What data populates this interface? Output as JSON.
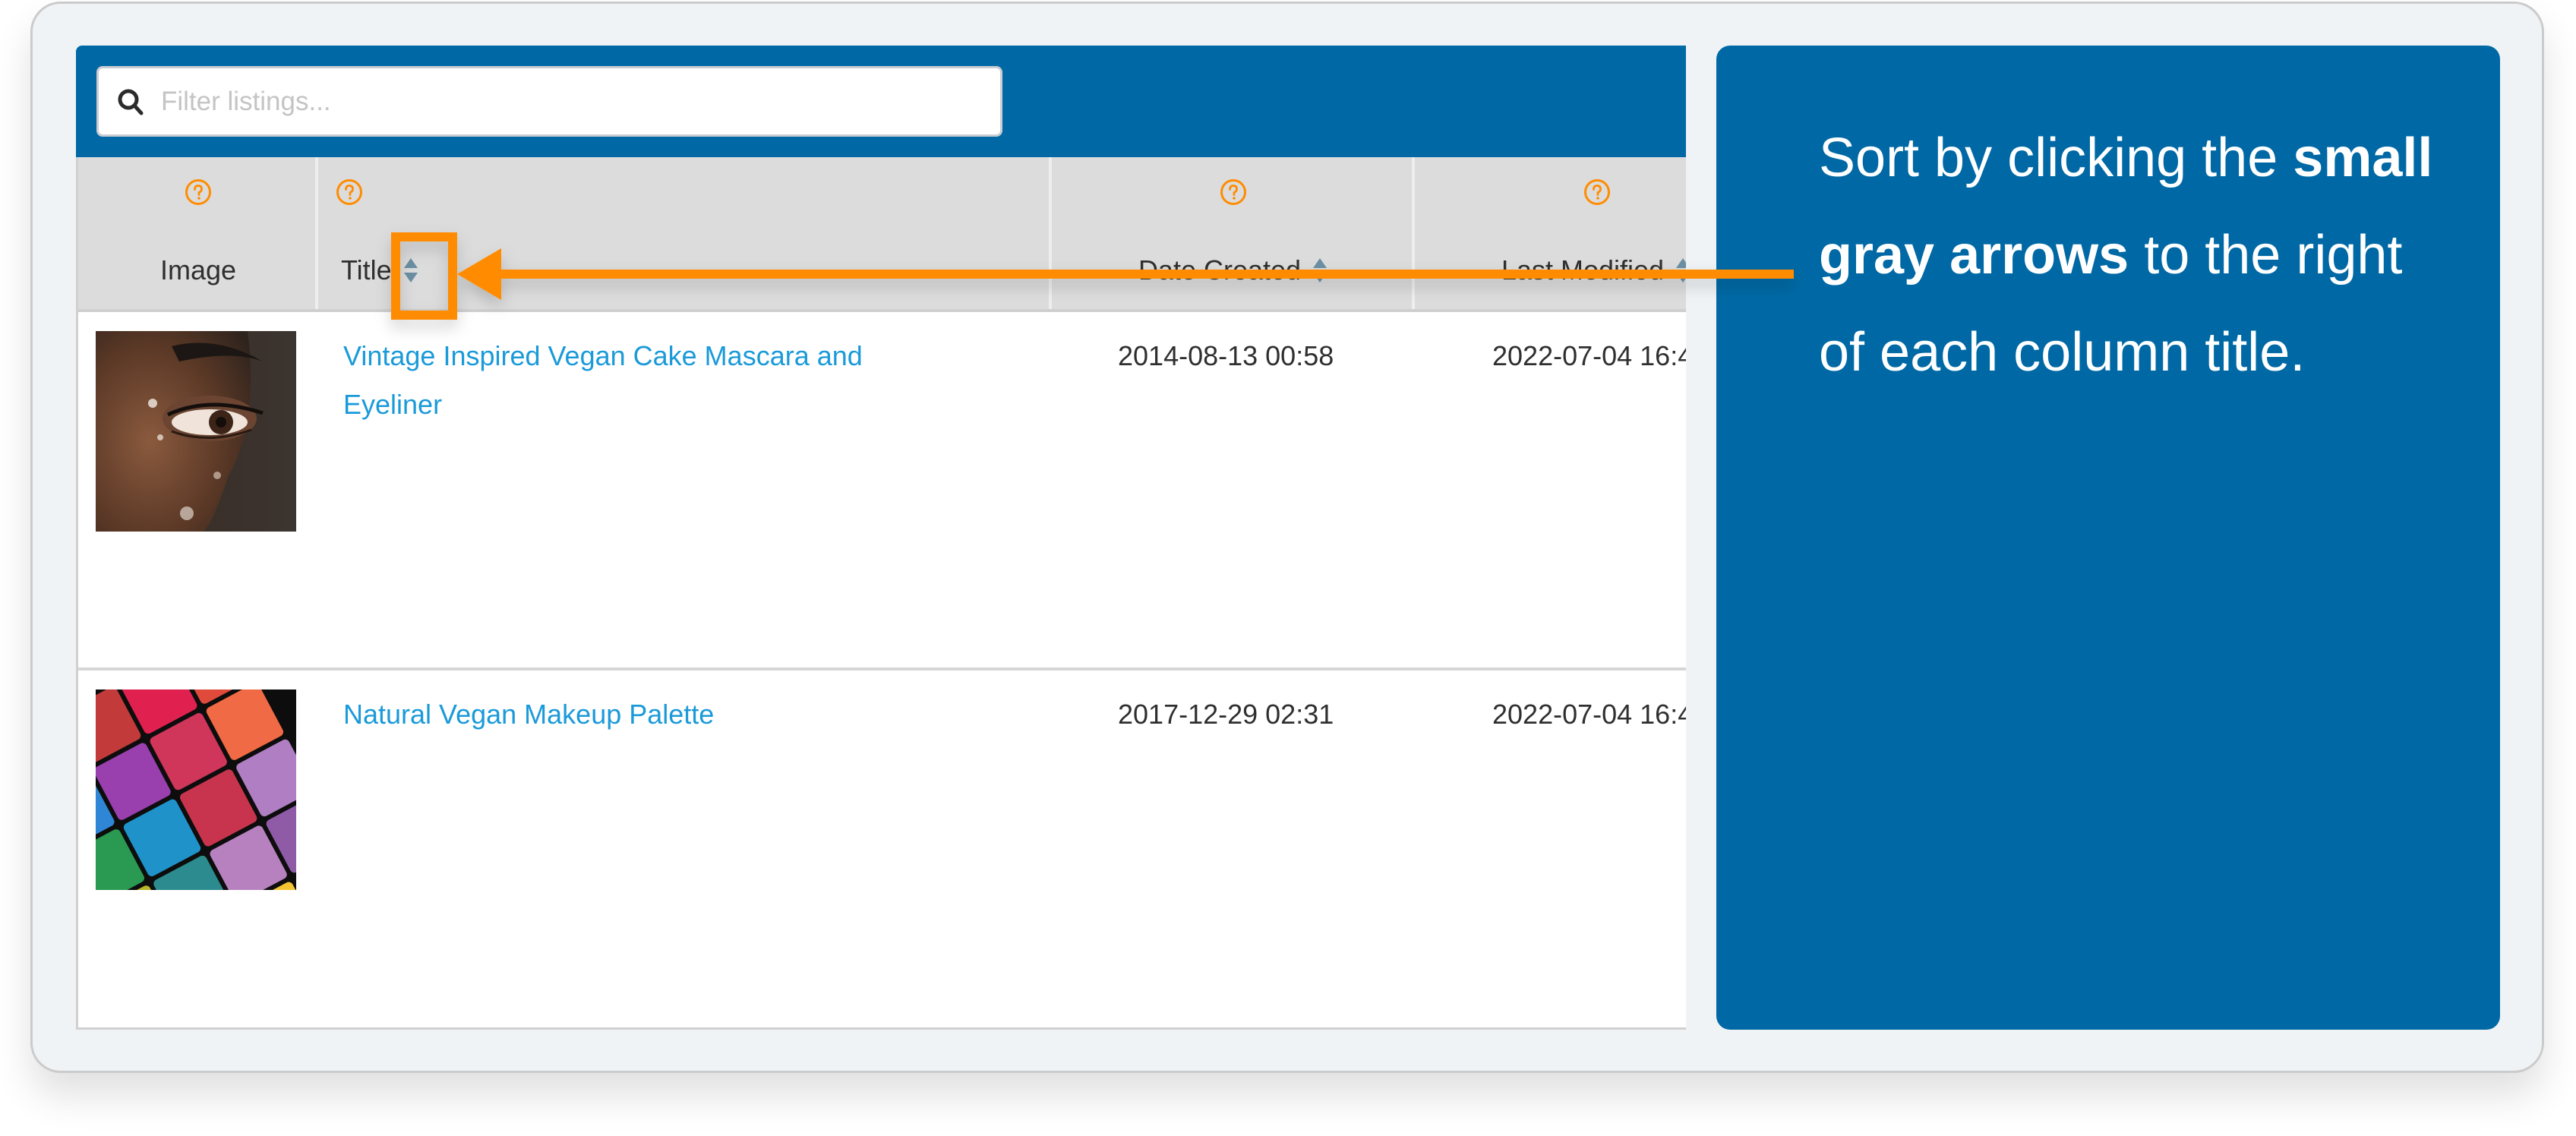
{
  "search": {
    "placeholder": "Filter listings...",
    "value": "",
    "icon": "search-icon"
  },
  "table": {
    "columns": [
      {
        "label": "Image",
        "help_icon": "help-circle-icon",
        "sortable": false
      },
      {
        "label": "Title",
        "help_icon": "help-circle-icon",
        "sortable": true,
        "sort_icon": "sort-arrows-icon"
      },
      {
        "label": "Date Created",
        "help_icon": "help-circle-icon",
        "sortable": true,
        "sort_icon": "sort-arrows-icon"
      },
      {
        "label": "Last Modified",
        "help_icon": "help-circle-icon",
        "sortable": true,
        "sort_icon": "sort-arrows-icon"
      }
    ],
    "rows": [
      {
        "image": "eye-closeup-thumbnail",
        "title": "Vintage Inspired Vegan Cake Mascara and Eyeliner",
        "date_created": "2014-08-13 00:58",
        "last_modified": "2022-07-04 16:4"
      },
      {
        "image": "eyeshadow-palette-thumbnail",
        "title": "Natural Vegan Makeup Palette",
        "date_created": "2017-12-29 02:31",
        "last_modified": "2022-07-04 16:4"
      }
    ]
  },
  "callout": {
    "text_before": "Sort by clicking the ",
    "text_bold": "small gray arrows",
    "text_after": " to the right of each column title."
  },
  "colors": {
    "brand_blue": "#0069a5",
    "annotation_orange": "#ff8c00",
    "link_blue": "#1a9ad9",
    "header_gray": "#dcdcdc",
    "sort_arrow_gray": "#6b8fa3",
    "help_icon_orange": "#ff8c00"
  }
}
